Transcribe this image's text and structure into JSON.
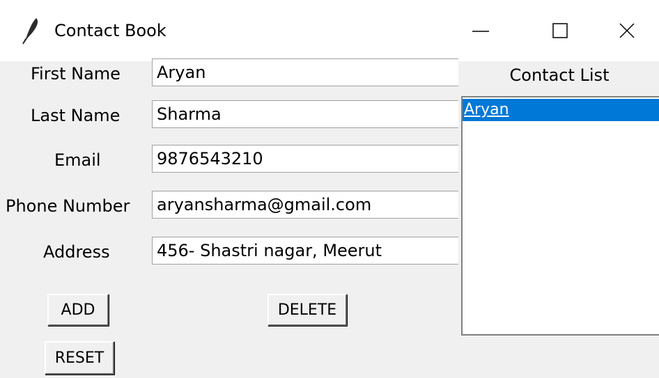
{
  "window": {
    "title": "Contact Book",
    "minimize_label": "—",
    "maximize_label": "☐",
    "close_label": "✕"
  },
  "form": {
    "fields": [
      {
        "label": "First Name",
        "value": "Aryan"
      },
      {
        "label": "Last Name",
        "value": "Sharma"
      },
      {
        "label": "Email",
        "value": "9876543210"
      },
      {
        "label": "Phone Number",
        "value": "aryansharma@gmail.com"
      },
      {
        "label": "Address",
        "value": "456- Shastri nagar, Meerut"
      }
    ]
  },
  "buttons": {
    "add": "ADD",
    "delete": "DELETE",
    "reset": "RESET"
  },
  "contact_list": {
    "title": "Contact List",
    "items": [
      "Aryan "
    ],
    "selected_color": "#0078d7"
  }
}
